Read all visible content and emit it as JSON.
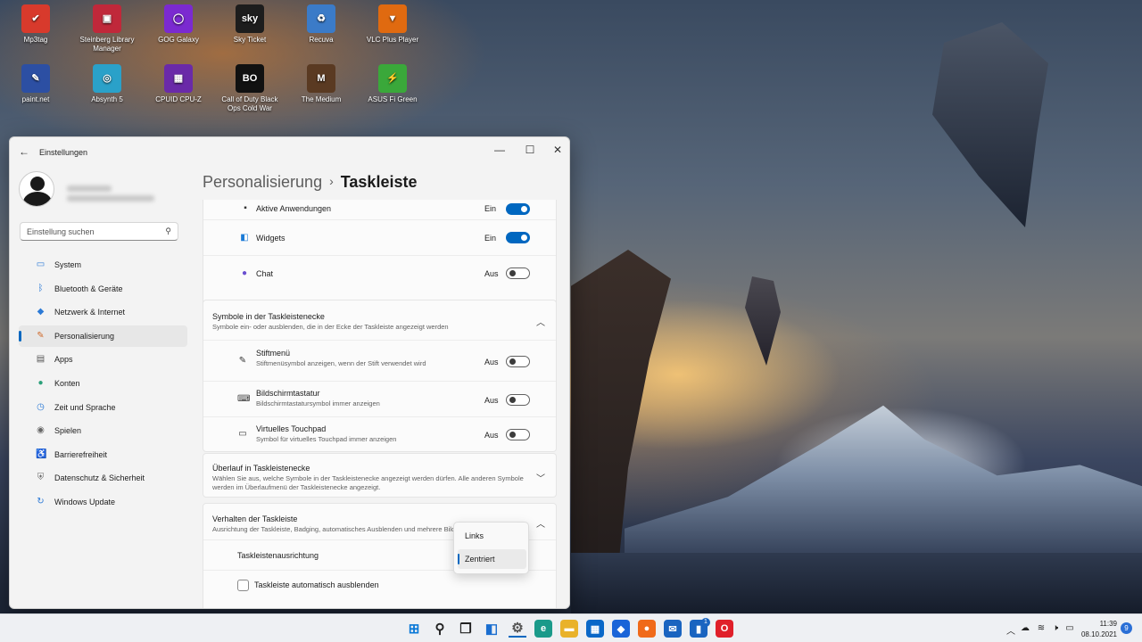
{
  "desktop": {
    "icons": [
      {
        "label": "Mp3tag",
        "glyph": "✔",
        "color": "#d83a2c"
      },
      {
        "label": "Steinberg Library Manager",
        "glyph": "▣",
        "color": "#c0283a"
      },
      {
        "label": "GOG Galaxy",
        "glyph": "◯",
        "color": "#7b2ad0"
      },
      {
        "label": "Sky Ticket",
        "glyph": "sky",
        "color": "#1d1d1d"
      },
      {
        "label": "Recuva",
        "glyph": "♻",
        "color": "#3b7bc8"
      },
      {
        "label": "VLC Plus Player",
        "glyph": "▼",
        "color": "#e06a10"
      },
      {
        "label": "paint.net",
        "glyph": "✎",
        "color": "#2c4fa3"
      },
      {
        "label": "Absynth 5",
        "glyph": "◎",
        "color": "#2aa1c9"
      },
      {
        "label": "CPUID CPU-Z",
        "glyph": "▦",
        "color": "#6a2aa8"
      },
      {
        "label": "Call of Duty Black Ops Cold War",
        "glyph": "BO",
        "color": "#111"
      },
      {
        "label": "The Medium",
        "glyph": "M",
        "color": "#5a3a22"
      },
      {
        "label": "ASUS Fi Green",
        "glyph": "⚡",
        "color": "#3aa83a"
      }
    ]
  },
  "window": {
    "title": "Einstellungen",
    "minimize": "—",
    "maximize": "☐",
    "close": "✕",
    "back": "←"
  },
  "sidebar": {
    "search_placeholder": "Einstellung suchen",
    "items": [
      {
        "label": "System",
        "icon": "monitor-icon",
        "glyph": "▭",
        "color": "#2c7ad6"
      },
      {
        "label": "Bluetooth & Geräte",
        "icon": "bluetooth-icon",
        "glyph": "ᛒ",
        "color": "#2c7ad6"
      },
      {
        "label": "Netzwerk & Internet",
        "icon": "wifi-icon",
        "glyph": "◆",
        "color": "#2c7ad6"
      },
      {
        "label": "Personalisierung",
        "icon": "brush-icon",
        "glyph": "✎",
        "color": "#d06a2a"
      },
      {
        "label": "Apps",
        "icon": "apps-icon",
        "glyph": "▤",
        "color": "#555"
      },
      {
        "label": "Konten",
        "icon": "account-icon",
        "glyph": "●",
        "color": "#2ca07a"
      },
      {
        "label": "Zeit und Sprache",
        "icon": "globe-clock-icon",
        "glyph": "◷",
        "color": "#2c7ad6"
      },
      {
        "label": "Spielen",
        "icon": "gamepad-icon",
        "glyph": "◉",
        "color": "#666"
      },
      {
        "label": "Barrierefreiheit",
        "icon": "accessibility-icon",
        "glyph": "♿",
        "color": "#2c7ad6"
      },
      {
        "label": "Datenschutz & Sicherheit",
        "icon": "shield-icon",
        "glyph": "⛨",
        "color": "#666"
      },
      {
        "label": "Windows Update",
        "icon": "update-icon",
        "glyph": "↻",
        "color": "#2c7ad6"
      }
    ],
    "active_index": 3
  },
  "content": {
    "breadcrumb_parent": "Personalisierung",
    "breadcrumb_separator": "›",
    "breadcrumb_current": "Taskleiste",
    "taskbar_items": [
      {
        "label": "Aktive Anwendungen",
        "state": "Ein",
        "on": true,
        "icon": "task-view-icon"
      },
      {
        "label": "Widgets",
        "state": "Ein",
        "on": true,
        "icon": "widgets-icon"
      },
      {
        "label": "Chat",
        "state": "Aus",
        "on": false,
        "icon": "chat-icon"
      }
    ],
    "corner_icons": {
      "title": "Symbole in der Taskleistenecke",
      "subtitle": "Symbole ein- oder ausblenden, die in der Ecke der Taskleiste angezeigt werden",
      "items": [
        {
          "label": "Stiftmenü",
          "sub": "Stiftmenüsymbol anzeigen, wenn der Stift verwendet wird",
          "state": "Aus",
          "on": false,
          "icon": "pen-icon"
        },
        {
          "label": "Bildschirmtastatur",
          "sub": "Bildschirmtastatursymbol immer anzeigen",
          "state": "Aus",
          "on": false,
          "icon": "keyboard-icon"
        },
        {
          "label": "Virtuelles Touchpad",
          "sub": "Symbol für virtuelles Touchpad immer anzeigen",
          "state": "Aus",
          "on": false,
          "icon": "touchpad-icon"
        }
      ]
    },
    "overflow": {
      "title": "Überlauf in Taskleistenecke",
      "subtitle": "Wählen Sie aus, welche Symbole in der Taskleistenecke angezeigt werden dürfen. Alle anderen Symbole werden im Überlaufmenü der Taskleistenecke angezeigt."
    },
    "behavior": {
      "title": "Verhalten der Taskleiste",
      "subtitle": "Ausrichtung der Taskleiste, Badging, automatisches Ausblenden und mehrere Bildschirme",
      "alignment_label": "Taskleistenausrichtung",
      "autohide_label": "Taskleiste automatisch ausblenden"
    },
    "dropdown": {
      "options": [
        "Links",
        "Zentriert"
      ],
      "selected": "Zentriert"
    }
  },
  "taskbar": {
    "time": "11:39",
    "date": "08.10.2021",
    "notifications": "9",
    "store_badge": "1",
    "apps": [
      {
        "icon": "start-icon",
        "glyph": "⊞",
        "color": "#0a78d7"
      },
      {
        "icon": "search-icon",
        "glyph": "⚲",
        "color": "#222"
      },
      {
        "icon": "task-view-icon",
        "glyph": "❐",
        "color": "#222"
      },
      {
        "icon": "widgets-icon",
        "glyph": "◧",
        "color": "#1a6ed0"
      },
      {
        "icon": "settings-icon",
        "glyph": "⚙",
        "color": "#555"
      },
      {
        "icon": "edge-icon",
        "glyph": "e",
        "color": "#1a9a8a"
      },
      {
        "icon": "explorer-icon",
        "glyph": "▬",
        "color": "#e9b22a"
      },
      {
        "icon": "store-icon",
        "glyph": "▦",
        "color": "#0a68c8"
      },
      {
        "icon": "dropbox-icon",
        "glyph": "◆",
        "color": "#1a64d8"
      },
      {
        "icon": "firefox-icon",
        "glyph": "●",
        "color": "#f06a1a"
      },
      {
        "icon": "mail-icon",
        "glyph": "✉",
        "color": "#1a64c0"
      },
      {
        "icon": "bluetooth-app-icon",
        "glyph": "▮",
        "color": "#1a64c0"
      },
      {
        "icon": "opera-icon",
        "glyph": "O",
        "color": "#e0202a"
      }
    ]
  }
}
